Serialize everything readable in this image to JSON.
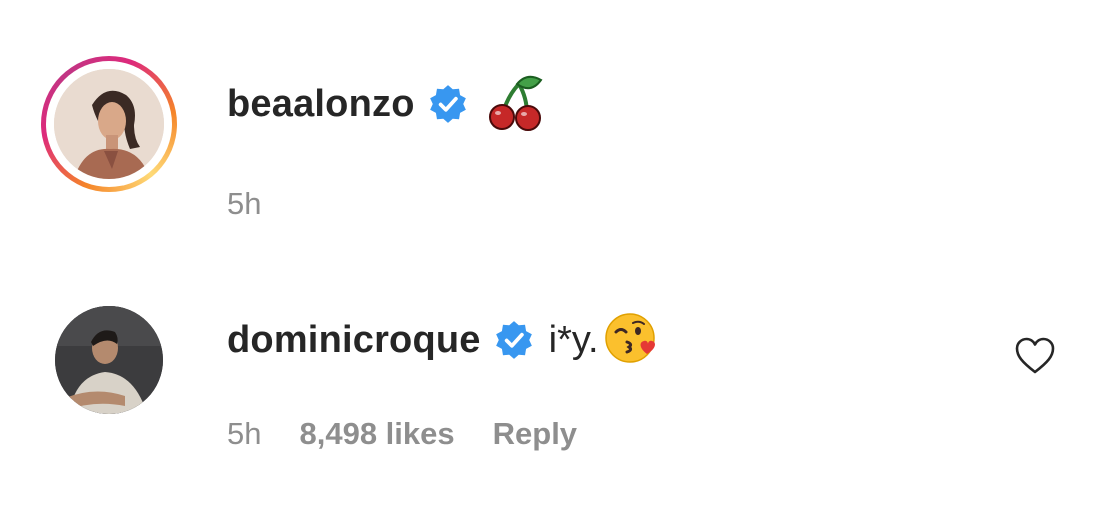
{
  "comments": [
    {
      "username": "beaalonzo",
      "verified": true,
      "text": "",
      "emoji": "cherries",
      "time": "5h",
      "likes": "",
      "reply": ""
    },
    {
      "username": "dominicroque",
      "verified": true,
      "text": "i*y.",
      "emoji": "face-blowing-a-kiss",
      "time": "5h",
      "likes": "8,498 likes",
      "reply": "Reply"
    }
  ],
  "colors": {
    "text": "#262626",
    "meta": "#8e8e8e",
    "verified": "#3897f0",
    "story_ring_start": "#f58529",
    "story_ring_end": "#dd2a7b"
  },
  "icons": [
    "verified-badge-icon",
    "cherries-emoji-icon",
    "kiss-emoji-icon",
    "heart-outline-icon"
  ]
}
